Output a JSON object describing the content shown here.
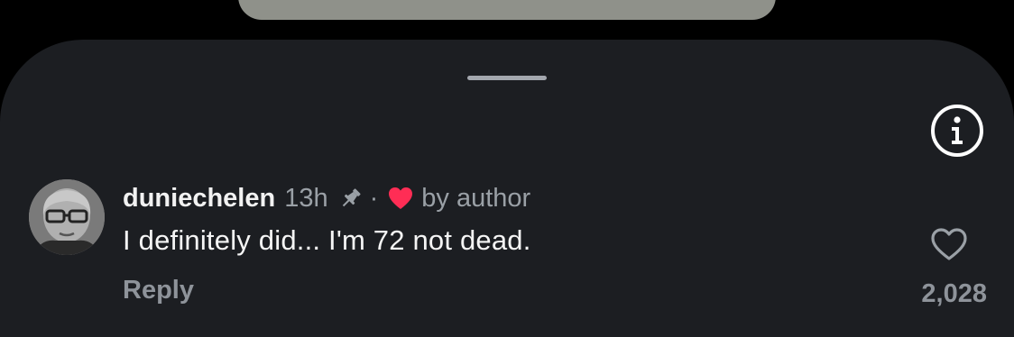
{
  "comment": {
    "username": "duniechelen",
    "time": "13h",
    "separator": "·",
    "liked_by": "by author",
    "text": "I definitely did... I'm 72 not dead.",
    "reply_label": "Reply",
    "like_count": "2,028"
  },
  "icons": {
    "info": "info-icon",
    "pin": "pin-icon",
    "author_heart": "heart-icon",
    "like": "heart-outline-icon"
  },
  "colors": {
    "sheet_background": "#1c1e22",
    "author_heart": "#ff2d55",
    "secondary_text": "#9aa0a6",
    "primary_text": "#f5f5f5"
  }
}
